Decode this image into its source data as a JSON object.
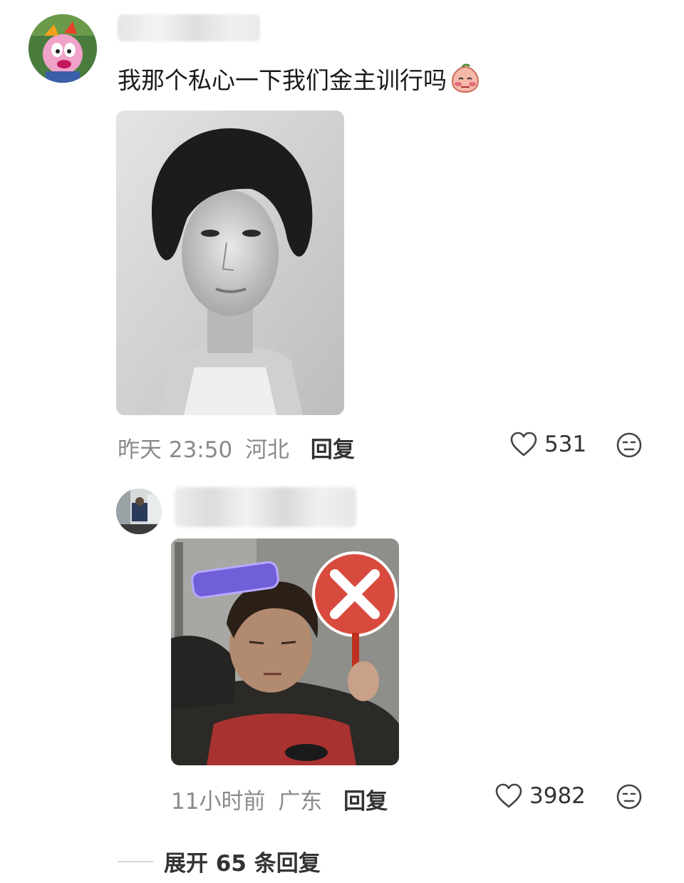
{
  "main_comment": {
    "text": "我那个私心一下我们金主训行吗",
    "meta_time": "昨天 23:50",
    "meta_location": "河北",
    "reply_label": "回复",
    "like_count": "531",
    "avatar_icon": "cartoon-avatar",
    "emoji": "peach-blush-emoji"
  },
  "reply_comment": {
    "meta_time": "11小时前",
    "meta_location": "广东",
    "reply_label": "回复",
    "like_count": "3982"
  },
  "expand": {
    "label": "展开 65 条回复"
  },
  "colors": {
    "meta_gray": "#8a8a8a",
    "text_dark": "#1a1a1a"
  }
}
